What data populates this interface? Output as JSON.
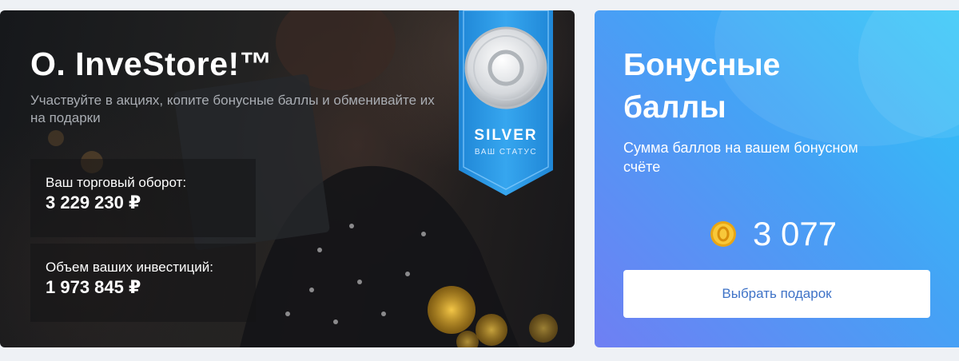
{
  "promo": {
    "title": "О. InveStore!™",
    "subtitle": "Участвуйте в акциях, копите бонусные баллы и обменивайте их на подарки",
    "turnover_label": "Ваш торговый оборот:",
    "turnover_value": "3 229 230 ₽",
    "investment_label": "Объем ваших инвестиций:",
    "investment_value": "1 973 845 ₽"
  },
  "status_badge": {
    "level": "SILVER",
    "caption": "ВАШ СТАТУС"
  },
  "bonus": {
    "title": "Бонусные баллы",
    "subtitle": "Сумма баллов на вашем бонусном счёте",
    "points": "3 077",
    "button_label": "Выбрать подарок"
  },
  "colors": {
    "ribbon_blue": "#2e9be8",
    "button_text": "#3f73c7",
    "coin_gold": "#f5b622"
  }
}
